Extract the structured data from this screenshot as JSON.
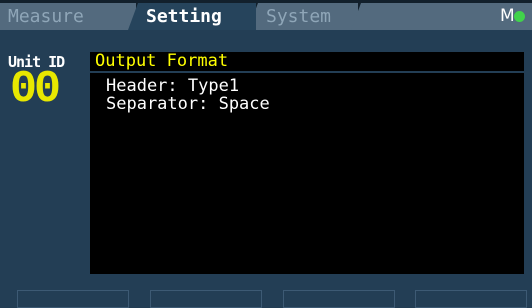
{
  "tabs": [
    {
      "label": "Measure",
      "active": false
    },
    {
      "label": "Setting",
      "active": true
    },
    {
      "label": "System",
      "active": false
    }
  ],
  "status": {
    "mode_letter": "M",
    "indicator_color": "#41d34b"
  },
  "unit": {
    "label": "Unit ID",
    "value": "00"
  },
  "panel": {
    "title": "Output Format",
    "lines": [
      "Header: Type1",
      "Separator: Space"
    ]
  },
  "colors": {
    "background": "#233e55",
    "title_text": "#ffff00",
    "unit_value": "#e8e800"
  }
}
